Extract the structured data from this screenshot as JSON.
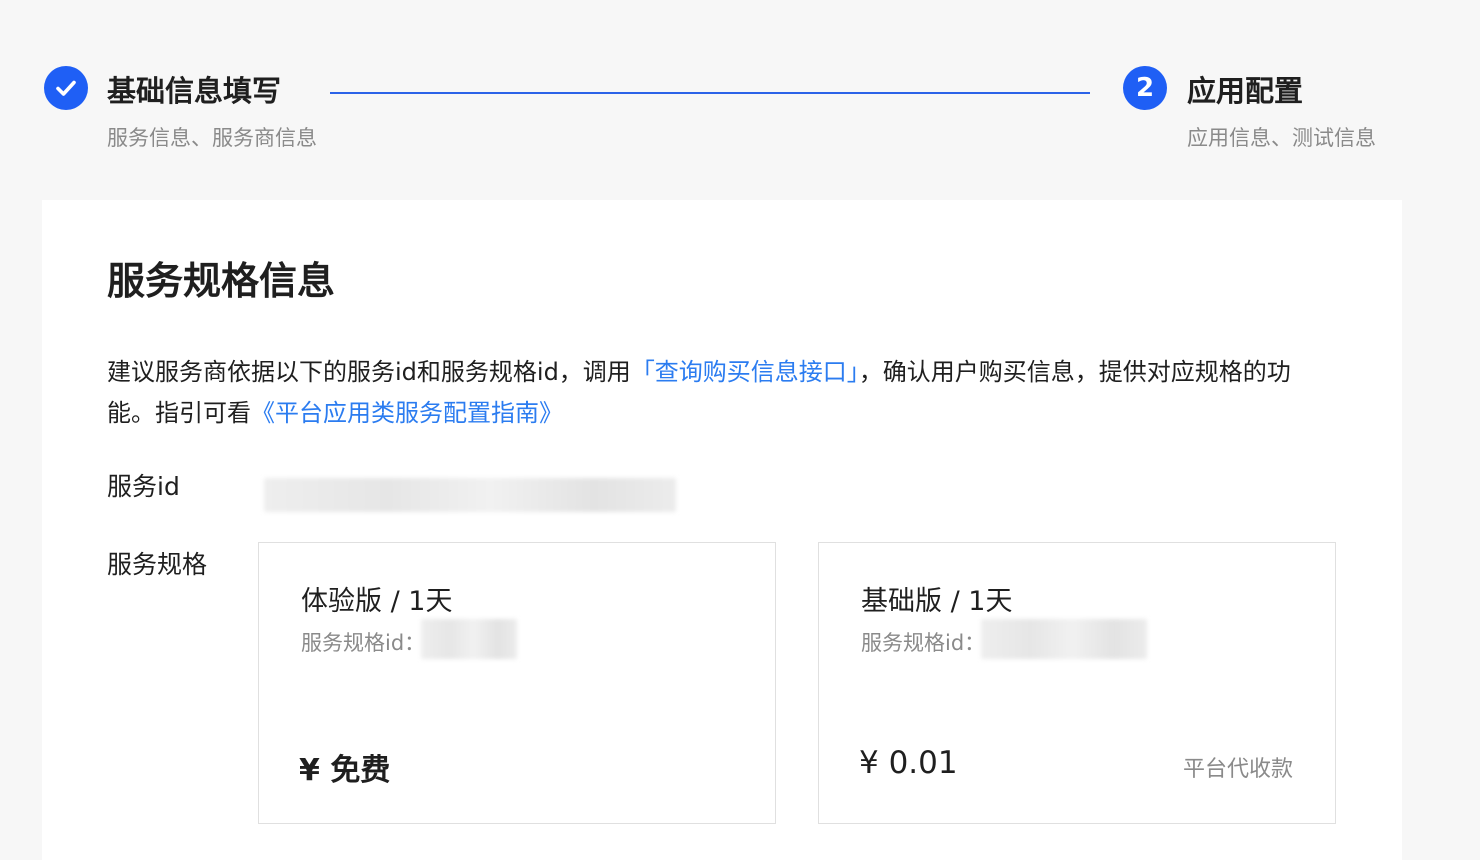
{
  "stepper": {
    "steps": [
      {
        "title": "基础信息填写",
        "subtitle": "服务信息、服务商信息",
        "status": "done"
      },
      {
        "number": "2",
        "title": "应用配置",
        "subtitle": "应用信息、测试信息",
        "status": "active"
      }
    ],
    "accent_color": "#1f5ff5"
  },
  "section": {
    "title": "服务规格信息",
    "description": {
      "part1": "建议服务商依据以下的服务id和服务规格id，调用",
      "link1": "「查询购买信息接口」",
      "part2": "，确认用户购买信息，提供对应规格的功能。指引可看",
      "link2": "《平台应用类服务配置指南》"
    },
    "service_id_label": "服务id",
    "spec_label": "服务规格",
    "specs": [
      {
        "name": "体验版 / 1天",
        "id_label": "服务规格id：",
        "price": "¥ 免费",
        "note": ""
      },
      {
        "name": "基础版 / 1天",
        "id_label": "服务规格id：",
        "price": "¥ 0.01",
        "note": "平台代收款"
      }
    ],
    "link_color": "#2b7cf0"
  }
}
